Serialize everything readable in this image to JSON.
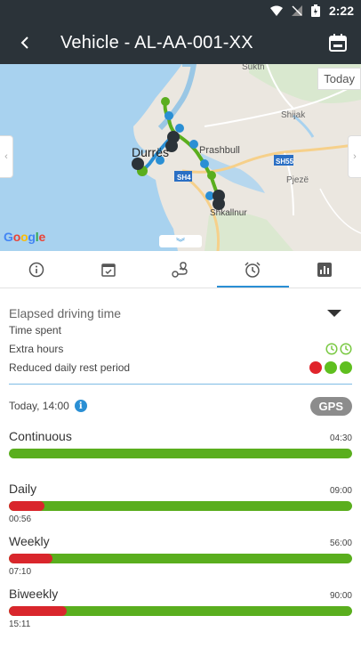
{
  "status_bar": {
    "time": "2:22"
  },
  "app_bar": {
    "title": "Vehicle - AL-AA-001-XX"
  },
  "map": {
    "today_label": "Today",
    "google_label": "Google",
    "places": [
      "Sukth",
      "Shijak",
      "Prashbull",
      "Pjezë",
      "Shkallnur",
      "Durrës"
    ],
    "roads": [
      "SH55",
      "SH4"
    ]
  },
  "tabs": [
    {
      "name": "info",
      "icon": "info-icon"
    },
    {
      "name": "calendar",
      "icon": "calendar-check-icon"
    },
    {
      "name": "route",
      "icon": "route-icon"
    },
    {
      "name": "driving-time",
      "icon": "alarm-clock-icon",
      "active": true
    },
    {
      "name": "stats",
      "icon": "bar-chart-icon"
    }
  ],
  "summary": {
    "title": "Elapsed driving time",
    "time_spent": "Time spent",
    "extra_hours": "Extra hours",
    "reduced_rest": "Reduced daily rest period",
    "colors": {
      "red": "#e0242b",
      "green": "#5fbf1f",
      "green_outline": "#7ac943"
    }
  },
  "gps": {
    "date": "Today, 14:00",
    "badge": "GPS"
  },
  "periods": [
    {
      "name": "Continuous",
      "limit": "04:30",
      "used": "",
      "progress": 0.0
    },
    {
      "name": "Daily",
      "limit": "09:00",
      "used": "00:56",
      "progress": 0.104
    },
    {
      "name": "Weekly",
      "limit": "56:00",
      "used": "07:10",
      "progress": 0.128
    },
    {
      "name": "Biweekly",
      "limit": "90:00",
      "used": "15:11",
      "progress": 0.169
    }
  ]
}
